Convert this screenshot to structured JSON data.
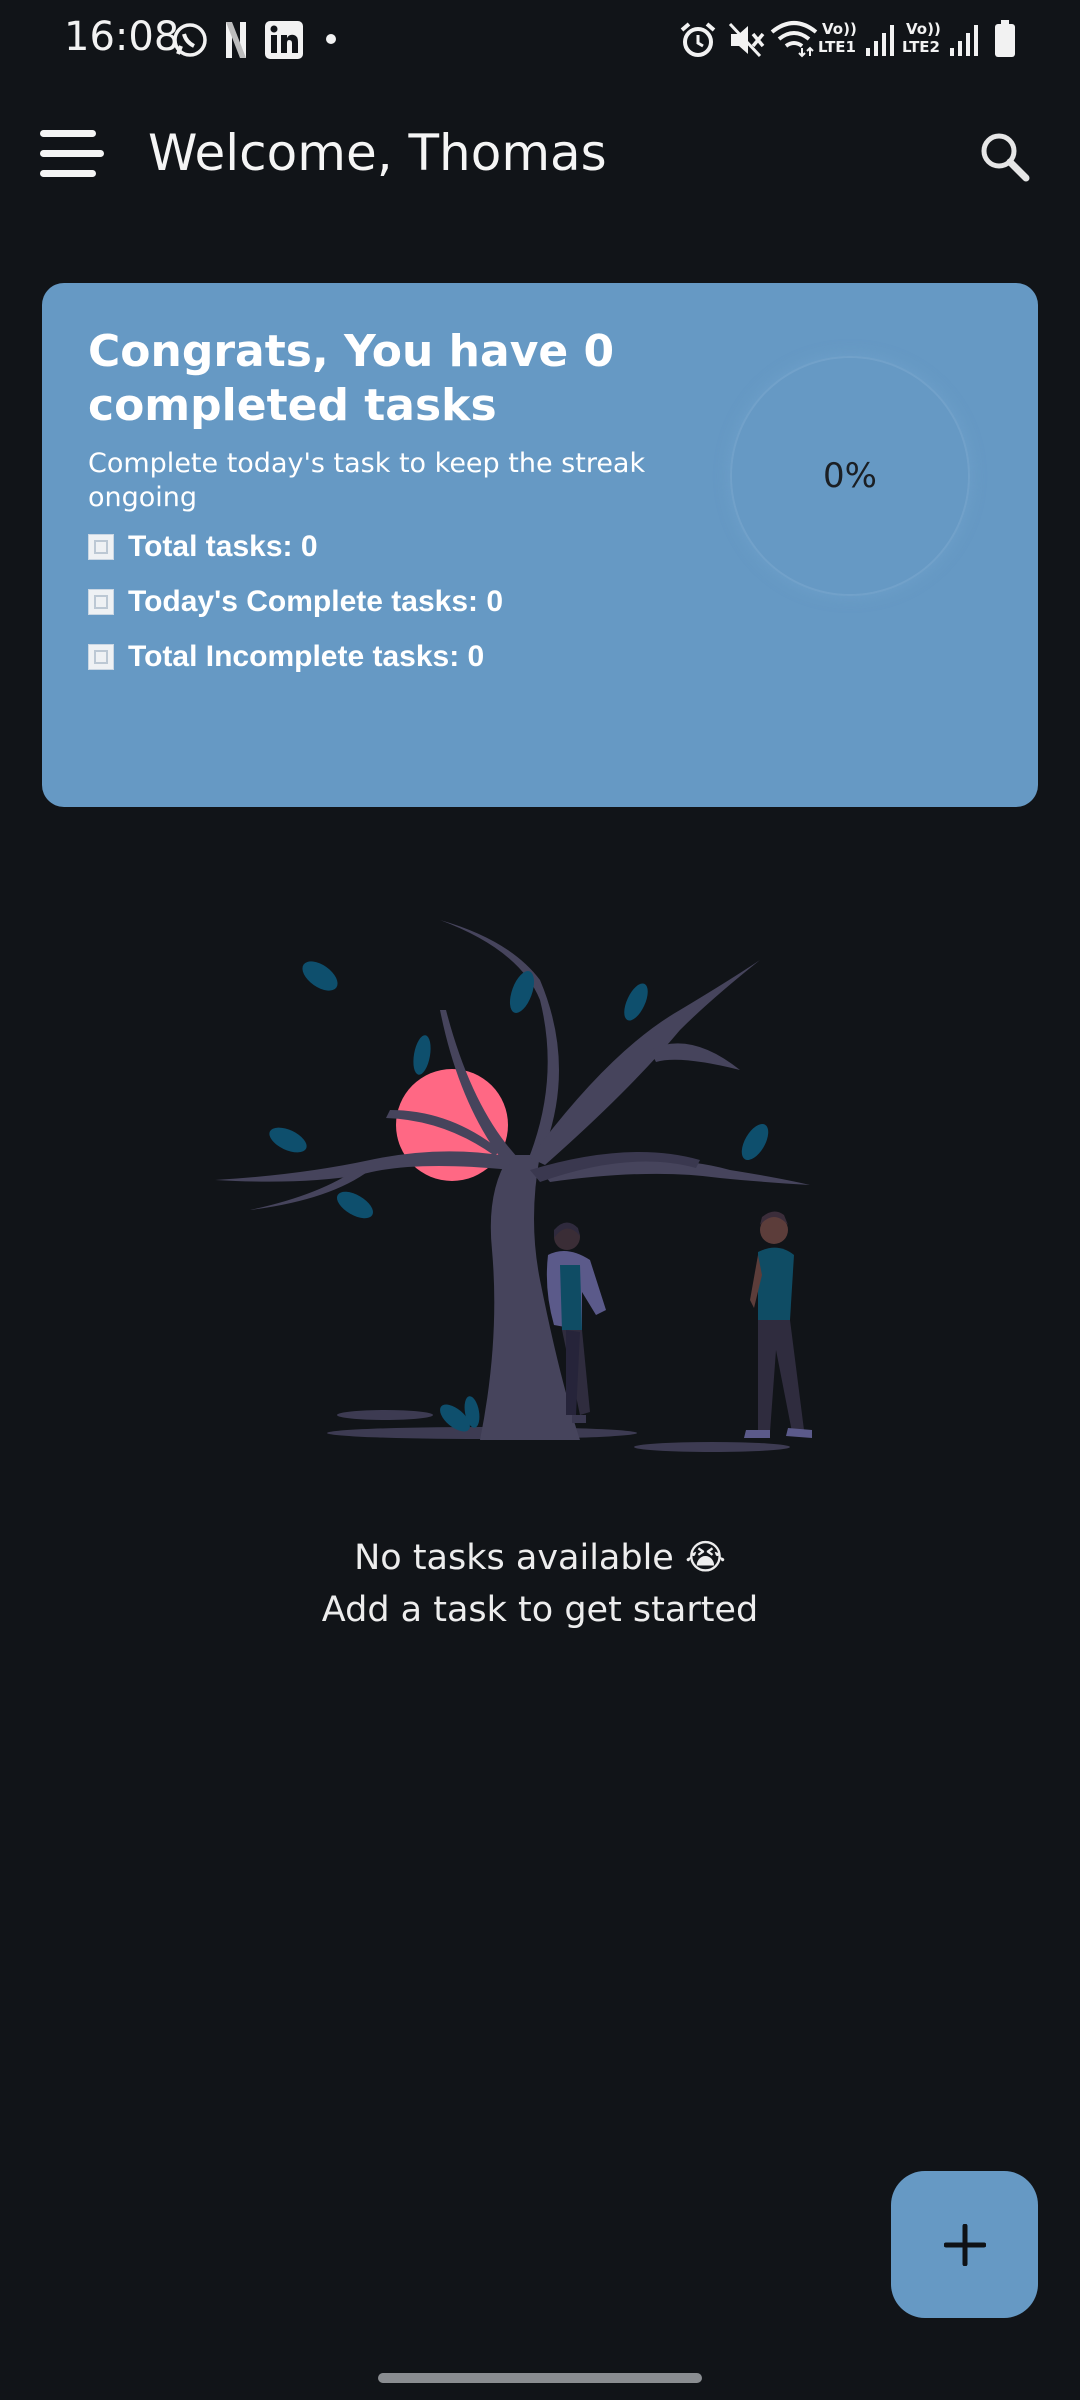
{
  "status_bar": {
    "time": "16:08",
    "sim1_label": "Vo))",
    "sim1_net": "LTE1",
    "sim2_label": "Vo))",
    "sim2_net": "LTE2",
    "left_icons": [
      "whatsapp-icon",
      "netflix-icon",
      "linkedin-icon",
      "dot-icon"
    ],
    "right_icons": [
      "alarm-icon",
      "mute-icon",
      "wifi-icon",
      "signal-icon",
      "signal-icon",
      "battery-icon"
    ]
  },
  "app_bar": {
    "title": "Welcome, Thomas",
    "menu_icon": "menu-icon",
    "search_icon": "search-icon"
  },
  "summary_card": {
    "title": "Congrats, You have 0 completed tasks",
    "subtitle": "Complete today's task to keep the streak ongoing",
    "stats": [
      {
        "label": "Total tasks: 0"
      },
      {
        "label": "Today's Complete tasks: 0"
      },
      {
        "label": "Total Incomplete tasks: 0"
      }
    ],
    "progress_text": "0%",
    "progress_value": 0,
    "card_color": "#6699c4"
  },
  "empty_state": {
    "title": "No tasks available 😭",
    "subtitle": "Add a task to get started"
  },
  "fab": {
    "icon": "plus-icon",
    "color": "#6699c4"
  },
  "colors": {
    "background": "#111418",
    "accent": "#6699c4"
  }
}
